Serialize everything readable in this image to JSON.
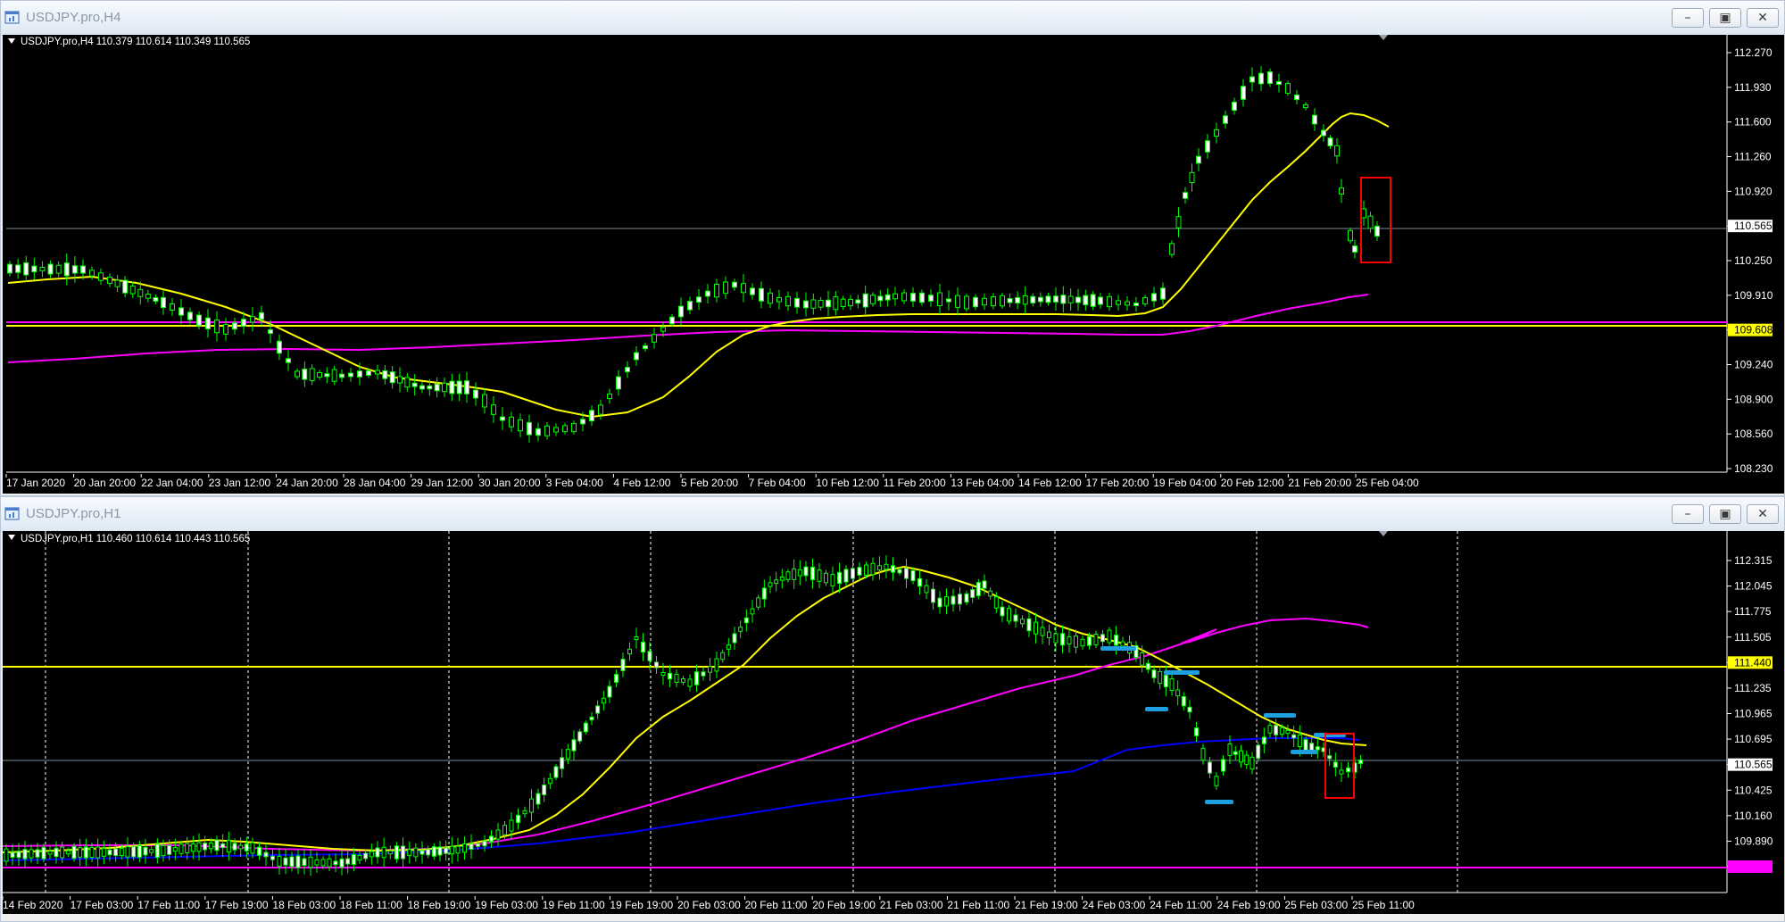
{
  "windows": [
    {
      "title": "USDJPY.pro,H4",
      "header": "USDJPY.pro,H4  110.379 110.614 110.349 110.565",
      "price_labels": [
        "112.270",
        "111.930",
        "111.600",
        "111.260",
        "110.920",
        "110.565",
        "110.250",
        "109.910",
        "109.608",
        "109.240",
        "108.900",
        "108.560",
        "108.230"
      ],
      "time_labels": [
        "17 Jan 2020",
        "20 Jan 20:00",
        "22 Jan 04:00",
        "23 Jan 12:00",
        "24 Jan 20:00",
        "28 Jan 04:00",
        "29 Jan 12:00",
        "30 Jan 20:00",
        "3 Feb 04:00",
        "4 Feb 12:00",
        "5 Feb 20:00",
        "7 Feb 04:00",
        "10 Feb 12:00",
        "11 Feb 20:00",
        "13 Feb 04:00",
        "14 Feb 12:00",
        "17 Feb 20:00",
        "19 Feb 04:00",
        "20 Feb 12:00",
        "21 Feb 20:00",
        "25 Feb 04:00"
      ],
      "current_price": "110.565",
      "hline_price": "109.608",
      "colors": {
        "bull": "#00ff00",
        "bear": "#ffffff",
        "ma_fast": "#ffff00",
        "ma_slow": "#ff00ff",
        "hline": "#ffff00",
        "current": "#778899",
        "highlight": "#ff0000"
      }
    },
    {
      "title": "USDJPY.pro,H1",
      "header": "USDJPY.pro,H1  110.460 110.614 110.443 110.565",
      "price_labels": [
        "112.315",
        "112.045",
        "111.775",
        "111.505",
        "111.440",
        "111.235",
        "110.965",
        "110.695",
        "110.565",
        "110.425",
        "110.160",
        "109.890",
        "109.564"
      ],
      "time_labels": [
        "14 Feb 2020",
        "17 Feb 03:00",
        "17 Feb 11:00",
        "17 Feb 19:00",
        "18 Feb 03:00",
        "18 Feb 11:00",
        "18 Feb 19:00",
        "19 Feb 03:00",
        "19 Feb 11:00",
        "19 Feb 19:00",
        "20 Feb 03:00",
        "20 Feb 11:00",
        "20 Feb 19:00",
        "21 Feb 03:00",
        "21 Feb 11:00",
        "21 Feb 19:00",
        "24 Feb 03:00",
        "24 Feb 11:00",
        "24 Feb 19:00",
        "25 Feb 03:00",
        "25 Feb 11:00"
      ],
      "current_price": "110.565",
      "hline_price": "111.440",
      "bottom_price": "109.564",
      "colors": {
        "bull": "#00ff00",
        "bear": "#ffffff",
        "ma_fast": "#ffff00",
        "ma_mid": "#ff00ff",
        "ma_slow": "#0000ff",
        "hline": "#ffff00",
        "current": "#778899",
        "highlight": "#ff0000",
        "marks": "#1e9fe0"
      }
    }
  ]
}
